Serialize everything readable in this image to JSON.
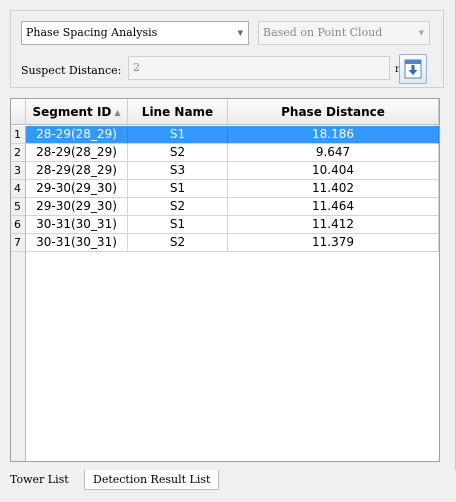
{
  "analysis": {
    "mode_selected": "Phase Spacing Analysis",
    "source_selected": "Based on Point Cloud",
    "suspect_label": "Suspect Distance:",
    "suspect_value": "2",
    "unit": "m",
    "export_icon": "download-arrow-icon"
  },
  "table": {
    "columns": [
      "Segment ID",
      "Line Name",
      "Phase Distance"
    ],
    "sort_icon": "▲",
    "rows": [
      {
        "num": "1",
        "segment": "28-29(28_29)",
        "line": "S1",
        "distance": "18.186"
      },
      {
        "num": "2",
        "segment": "28-29(28_29)",
        "line": "S2",
        "distance": "9.647"
      },
      {
        "num": "3",
        "segment": "28-29(28_29)",
        "line": "S3",
        "distance": "10.404"
      },
      {
        "num": "4",
        "segment": "29-30(29_30)",
        "line": "S1",
        "distance": "11.402"
      },
      {
        "num": "5",
        "segment": "29-30(29_30)",
        "line": "S2",
        "distance": "11.464"
      },
      {
        "num": "6",
        "segment": "30-31(30_31)",
        "line": "S1",
        "distance": "11.412"
      },
      {
        "num": "7",
        "segment": "30-31(30_31)",
        "line": "S2",
        "distance": "11.379"
      }
    ],
    "selected_row": 0,
    "selection_color": "#3399ff"
  },
  "tabs": [
    "Tower List",
    "Detection Result List"
  ],
  "active_tab": 0
}
